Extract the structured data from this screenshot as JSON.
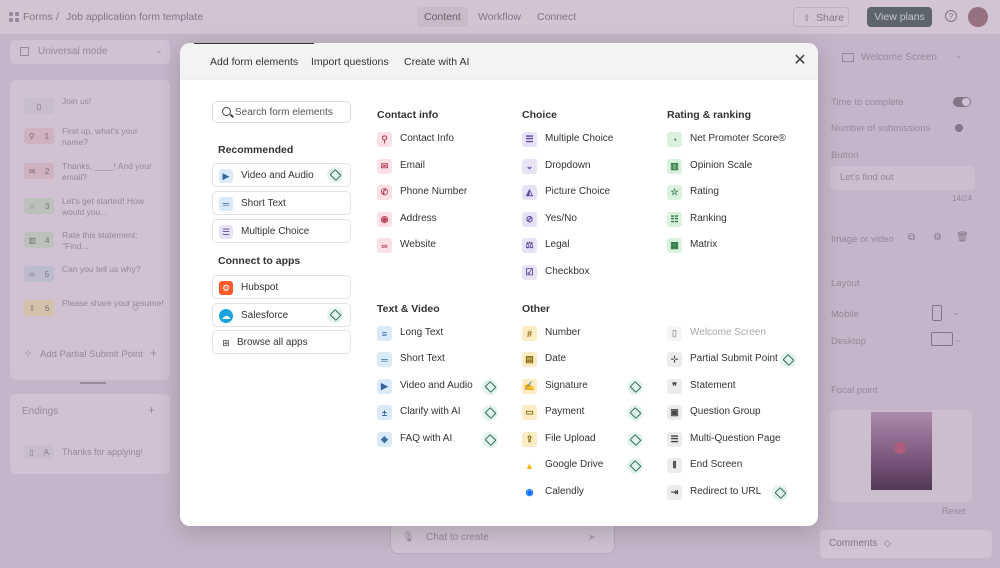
{
  "topbar": {
    "breadcrumb_root": "Forms",
    "breadcrumb_sep": "/",
    "form_title": "Job application form template",
    "nav": [
      "Content",
      "Workflow",
      "Connect"
    ],
    "share_label": "Share",
    "view_plans_label": "View plans",
    "help_label": "?"
  },
  "left_panel": {
    "mode_label": "Universal mode",
    "items": [
      {
        "num": "",
        "text": "Join us!"
      },
      {
        "num": "1",
        "text": "First up, what's your name?"
      },
      {
        "num": "2",
        "text": "Thanks, ____! And your email?"
      },
      {
        "num": "3",
        "text": "Let's get started! How would you..."
      },
      {
        "num": "4",
        "text": "Rate this statement: \"Find..."
      },
      {
        "num": "5",
        "text": "Can you tell us why?"
      },
      {
        "num": "6",
        "text": "Please share your resume!"
      }
    ],
    "partial_submit": "Add Partial Submit Point",
    "endings_label": "Endings",
    "ending_item": {
      "num": "A",
      "text": "Thanks for applying!"
    }
  },
  "right_panel": {
    "screen_select": "Welcome Screen",
    "time_to_complete": "Time to complete",
    "number_of_submissions": "Number of submissions",
    "button_label": "Button",
    "button_value": "Let's find out",
    "char_count": "14/24",
    "image_or_video": "Image or video",
    "layout_label": "Layout",
    "mobile": "Mobile",
    "desktop": "Desktop",
    "focal_point": "Focal point",
    "reset": "Reset",
    "comments": "Comments"
  },
  "chat": {
    "placeholder": "Chat to create"
  },
  "modal": {
    "tabs": [
      "Add form elements",
      "Import questions",
      "Create with AI"
    ],
    "search_placeholder": "Search form elements",
    "recommended_label": "Recommended",
    "recommended": [
      "Video and Audio",
      "Short Text",
      "Multiple Choice"
    ],
    "connect_label": "Connect to apps",
    "apps": [
      "Hubspot",
      "Salesforce",
      "Browse all apps"
    ],
    "contact": {
      "title": "Contact info",
      "items": [
        "Contact Info",
        "Email",
        "Phone Number",
        "Address",
        "Website"
      ]
    },
    "choice": {
      "title": "Choice",
      "items": [
        "Multiple Choice",
        "Dropdown",
        "Picture Choice",
        "Yes/No",
        "Legal",
        "Checkbox"
      ]
    },
    "rating": {
      "title": "Rating & ranking",
      "items": [
        "Net Promoter Score®",
        "Opinion Scale",
        "Rating",
        "Ranking",
        "Matrix"
      ]
    },
    "text_video": {
      "title": "Text & Video",
      "items": [
        "Long Text",
        "Short Text",
        "Video and Audio",
        "Clarify with AI",
        "FAQ with AI"
      ]
    },
    "other": {
      "title": "Other",
      "items": [
        "Number",
        "Date",
        "Signature",
        "Payment",
        "File Upload",
        "Google Drive",
        "Calendly"
      ]
    },
    "misc": {
      "items": [
        "Welcome Screen",
        "Partial Submit Point",
        "Statement",
        "Question Group",
        "Multi-Question Page",
        "End Screen",
        "Redirect to URL"
      ]
    }
  }
}
